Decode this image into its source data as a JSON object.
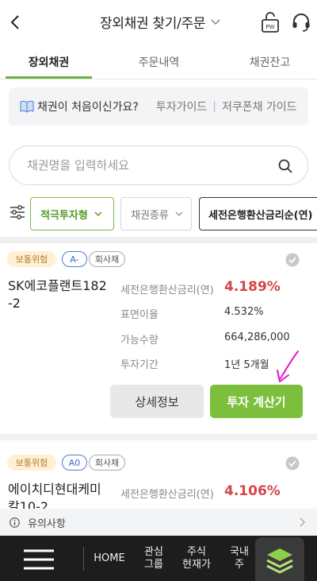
{
  "header": {
    "title": "장외채권 찾기/주문",
    "pw_label": "PW"
  },
  "tabs": [
    {
      "label": "장외채권",
      "active": true
    },
    {
      "label": "주문내역",
      "active": false
    },
    {
      "label": "채권잔고",
      "active": false
    }
  ],
  "guide": {
    "question": "채권이 처음이신가요?",
    "link1": "투자가이드",
    "link2": "저쿠폰채 가이드"
  },
  "search": {
    "placeholder": "채권명을 입력하세요",
    "value": ""
  },
  "filters": [
    {
      "label": "적극투자형",
      "selected": true
    },
    {
      "label": "채권종류",
      "selected": false
    },
    {
      "label": "세전은행환산금리순(연)",
      "selected": false
    }
  ],
  "bonds": [
    {
      "risk": "보통위험",
      "grade": "A-",
      "kind": "회사채",
      "name": "SK에코플랜트182-2",
      "rate_label": "세전은행환산금리(연)",
      "rate": "4.189%",
      "coupon_label": "표면이율",
      "coupon": "4.532%",
      "qty_label": "가능수량",
      "qty": "664,286,000",
      "term_label": "투자기간",
      "term": "1년 5개월",
      "detail_button": "상세정보",
      "calc_button": "투자 계산기"
    },
    {
      "risk": "보통위험",
      "grade": "A0",
      "kind": "회사채",
      "name": "에이치디현대케미칼10-2",
      "rate_label": "세전은행환산금리(연)",
      "rate": "4.106%"
    }
  ],
  "notice": {
    "label": "유의사항"
  },
  "bottom_nav": [
    {
      "label": "HOME"
    },
    {
      "label": "관심\n그룹"
    },
    {
      "label": "주식\n현재가"
    },
    {
      "label": "국내\n주"
    }
  ],
  "colors": {
    "accent": "#7bbf3c",
    "rate_red": "#d64545",
    "nav_bg": "#1d1d1d"
  }
}
